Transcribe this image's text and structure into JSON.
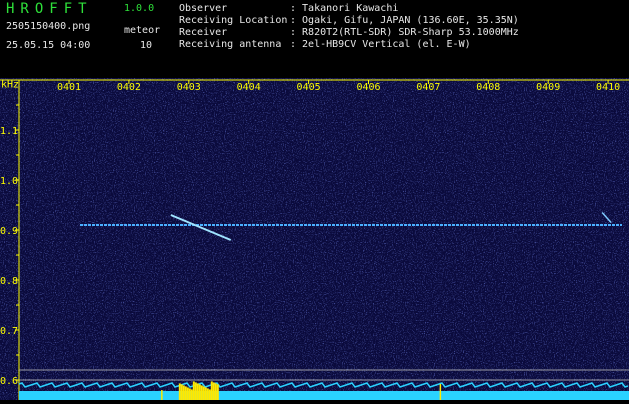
{
  "header": {
    "app_name": "HROFFT",
    "version": "1.0.0",
    "file_name": "2505150400.png",
    "datetime": "25.05.15 04:00",
    "mode_label": "meteor",
    "count": "10",
    "info": [
      {
        "key": "Observer",
        "value": ": Takanori Kawachi"
      },
      {
        "key": "Receiving Location",
        "value": ": Ogaki, Gifu, JAPAN (136.60E, 35.35N)"
      },
      {
        "key": "Receiver",
        "value": ": R820T2(RTL-SDR) SDR-Sharp 53.1000MHz"
      },
      {
        "key": "Receiving antenna",
        "value": ": 2el-HB9CV Vertical (el. E-W)"
      }
    ]
  },
  "chart_data": {
    "type": "heatmap",
    "ylabel": "kHz",
    "x_ticks": [
      "0401",
      "0402",
      "0403",
      "0404",
      "0405",
      "0406",
      "0407",
      "0408",
      "0409",
      "0410"
    ],
    "y_ticks": [
      "1.1",
      "1.0",
      "0.9",
      "0.8",
      "0.7",
      "0.6"
    ],
    "ylim": [
      0.58,
      1.17
    ],
    "carrier_khz": 0.91,
    "meteor_echo": {
      "start_minute": 2.7,
      "end_minute": 3.7,
      "freq_start_khz": 0.93,
      "freq_end_khz": 0.88
    },
    "colors": {
      "background": "#0a0a3c",
      "signal": "#4ab0ff",
      "axis": "#ffff00",
      "label": "#ffff00",
      "burst": "#ffe800",
      "baseline": "#2ad2ff"
    }
  }
}
